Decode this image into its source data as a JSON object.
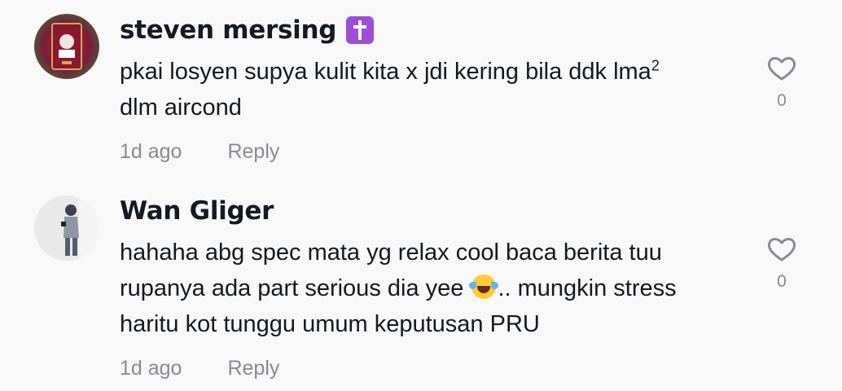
{
  "comments": [
    {
      "username": "steven mersing",
      "badge_icon": "latin-cross-icon",
      "text_part1": "pkai losyen supya kulit kita x jdi kering bila ddk lma",
      "text_sup": "2",
      "text_part2": "dlm aircond",
      "time": "1d ago",
      "reply_label": "Reply",
      "likes": "0"
    },
    {
      "username": "Wan Gliger",
      "text_part1": "hahaha abg spec mata yg relax cool baca berita tuu rupanya ada part serious dia yee",
      "emoji": "face-with-tears-of-joy-icon",
      "text_part2": ".. mungkin stress haritu kot tunggu umum keputusan PRU",
      "time": "1d ago",
      "reply_label": "Reply",
      "likes": "0"
    }
  ],
  "colors": {
    "background": "#f8f8f8",
    "text": "#161823",
    "muted": "#8a8b91",
    "badge": "#9c4fd6"
  }
}
